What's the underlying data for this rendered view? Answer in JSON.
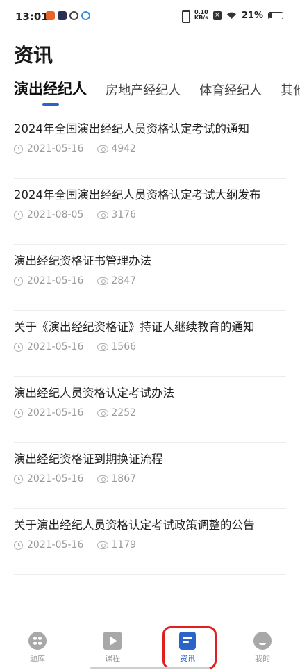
{
  "status_bar": {
    "time": "13:01",
    "net_speed_value": "0.10",
    "net_speed_unit": "KB/s",
    "battery": "21%"
  },
  "header": {
    "title": "资讯"
  },
  "tabs": [
    {
      "label": "演出经纪人",
      "active": true
    },
    {
      "label": "房地产经纪人",
      "active": false
    },
    {
      "label": "体育经纪人",
      "active": false
    },
    {
      "label": "其他经",
      "active": false
    }
  ],
  "news": [
    {
      "title": "2024年全国演出经纪人员资格认定考试的通知",
      "date": "2021-05-16",
      "views": "4942"
    },
    {
      "title": "2024年全国演出经纪人员资格认定考试大纲发布",
      "date": "2021-08-05",
      "views": "3176"
    },
    {
      "title": "演出经纪资格证书管理办法",
      "date": "2021-05-16",
      "views": "2847"
    },
    {
      "title": "关于《演出经纪资格证》持证人继续教育的通知",
      "date": "2021-05-16",
      "views": "1566"
    },
    {
      "title": "演出经纪人员资格认定考试办法",
      "date": "2021-05-16",
      "views": "2252"
    },
    {
      "title": "演出经纪资格证到期换证流程",
      "date": "2021-05-16",
      "views": "1867"
    },
    {
      "title": "关于演出经纪人员资格认定考试政策调整的公告",
      "date": "2021-05-16",
      "views": "1179"
    }
  ],
  "bottom_nav": [
    {
      "label": "题库",
      "icon": "grid-icon"
    },
    {
      "label": "课程",
      "icon": "play-icon"
    },
    {
      "label": "资讯",
      "icon": "news-icon"
    },
    {
      "label": "我的",
      "icon": "user-icon"
    }
  ],
  "colors": {
    "accent": "#2b64c8",
    "highlight": "#e02020"
  }
}
